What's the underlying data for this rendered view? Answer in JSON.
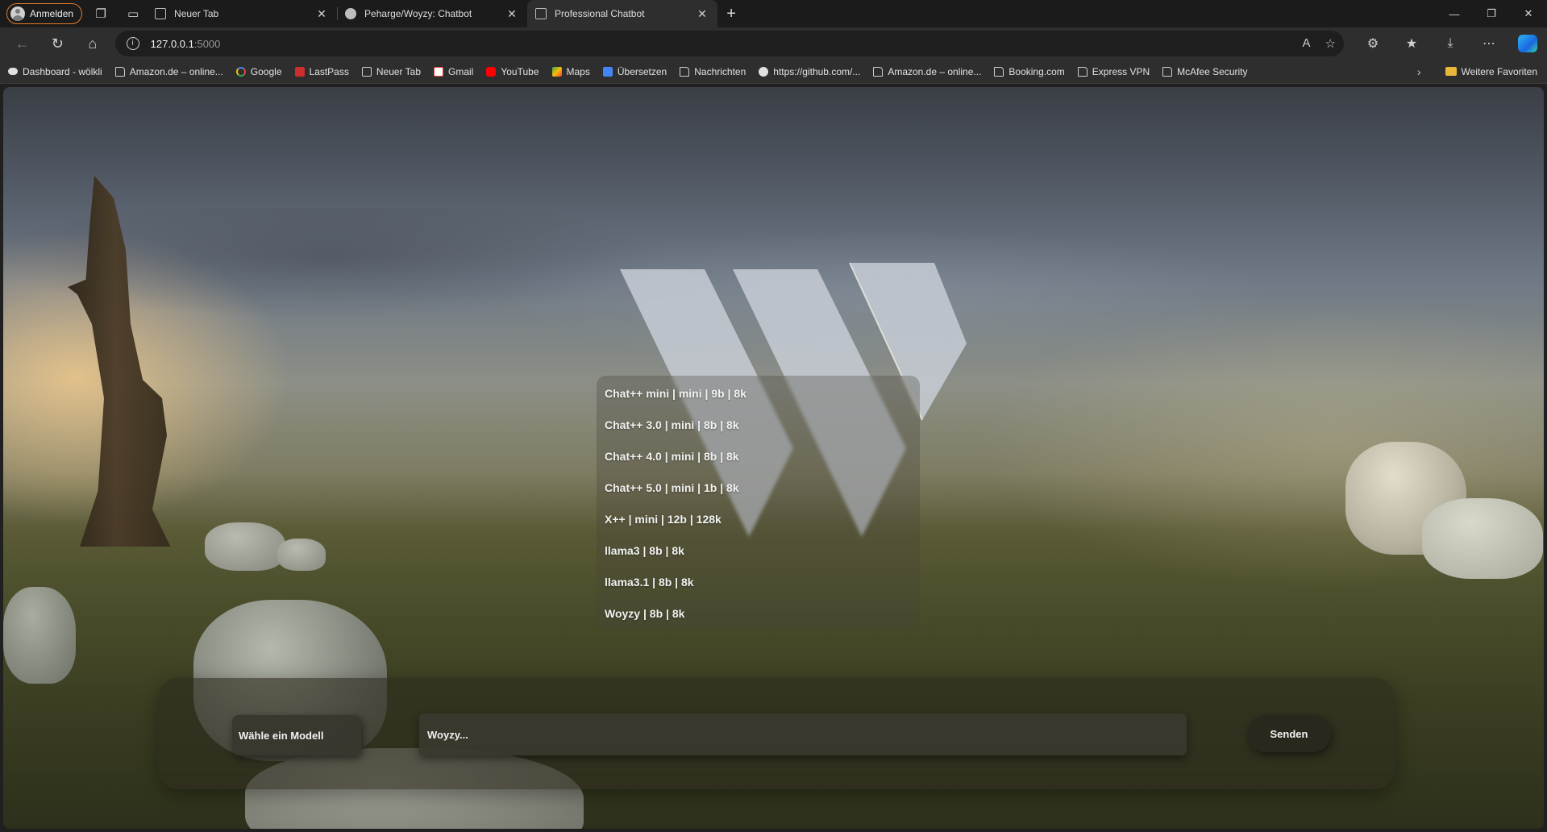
{
  "browser": {
    "profile_label": "Anmelden",
    "tabs": [
      {
        "label": "Neuer Tab",
        "icon": "page-icon"
      },
      {
        "label": "Peharge/Woyzy: Chatbot",
        "icon": "github-icon"
      },
      {
        "label": "Professional Chatbot",
        "icon": "page-icon"
      }
    ],
    "url_host": "127.0.0.1",
    "url_port": ":5000",
    "favorites": [
      {
        "label": "Dashboard - wölkli",
        "icon": "cloud"
      },
      {
        "label": "Amazon.de – online...",
        "icon": "doc"
      },
      {
        "label": "Google",
        "icon": "g"
      },
      {
        "label": "LastPass",
        "icon": "lp"
      },
      {
        "label": "Neuer Tab",
        "icon": "page"
      },
      {
        "label": "Gmail",
        "icon": "gm"
      },
      {
        "label": "YouTube",
        "icon": "yt"
      },
      {
        "label": "Maps",
        "icon": "maps"
      },
      {
        "label": "Übersetzen",
        "icon": "tr"
      },
      {
        "label": "Nachrichten",
        "icon": "doc"
      },
      {
        "label": "https://github.com/...",
        "icon": "gh"
      },
      {
        "label": "Amazon.de – online...",
        "icon": "doc"
      },
      {
        "label": "Booking.com",
        "icon": "doc"
      },
      {
        "label": "Express VPN",
        "icon": "doc"
      },
      {
        "label": "McAfee Security",
        "icon": "doc"
      }
    ],
    "more_favorites_label": "Weitere Favoriten",
    "accent_color": "#e07b2b"
  },
  "app": {
    "models": [
      "Chat++ mini | mini | 9b | 8k",
      "Chat++ 3.0 | mini | 8b | 8k",
      "Chat++ 4.0 | mini | 8b | 8k",
      "Chat++ 5.0 | mini | 1b | 8k",
      "X++ | mini | 12b | 128k",
      "llama3 | 8b | 8k",
      "llama3.1 | 8b | 8k",
      "Woyzy | 8b | 8k"
    ],
    "model_select_label": "Wähle ein Modell",
    "input_placeholder": "Woyzy...",
    "send_label": "Senden"
  }
}
